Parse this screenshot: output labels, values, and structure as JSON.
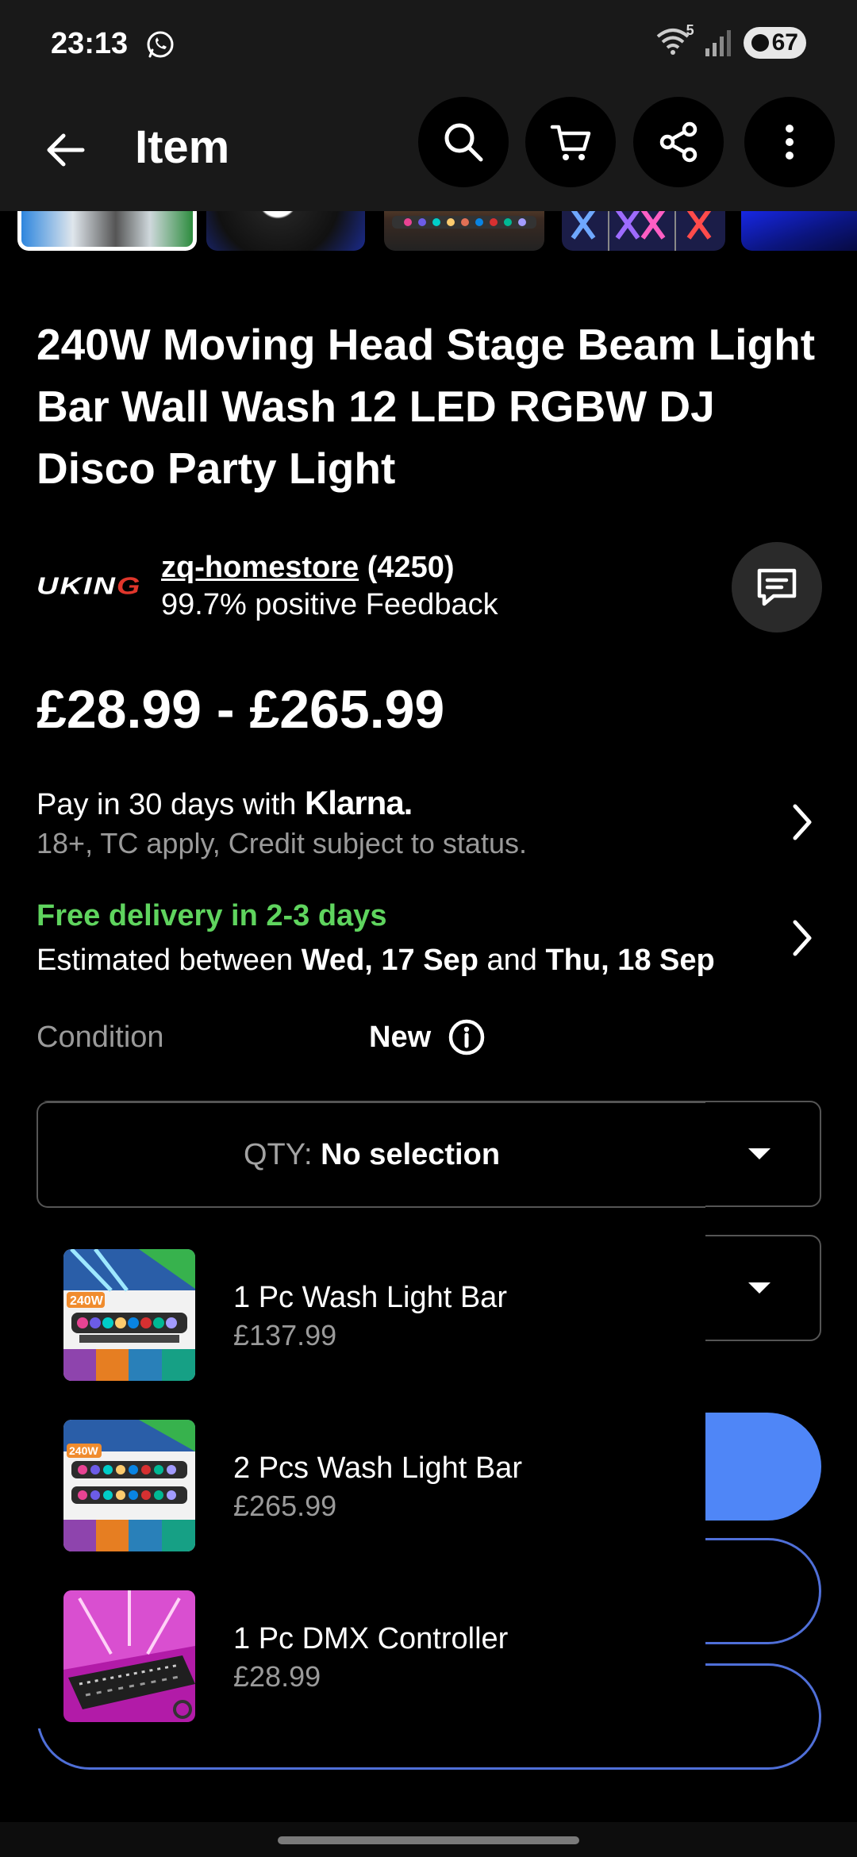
{
  "status_bar": {
    "time": "23:13",
    "network_badge": "5",
    "battery": "67",
    "icons": [
      "whatsapp-icon",
      "wifi-icon",
      "signal-icon",
      "battery-icon"
    ]
  },
  "app_bar": {
    "title": "Item",
    "icons": [
      "back-arrow-icon",
      "search-icon",
      "cart-icon",
      "share-icon",
      "more-vertical-icon"
    ]
  },
  "item": {
    "title": "240W Moving Head Stage Beam Light Bar Wall Wash 12 LED RGBW DJ Disco Party Light",
    "price_range": "£28.99 - £265.99"
  },
  "seller": {
    "logo_text": "UKING",
    "name": "zq-homestore",
    "count": "(4250)",
    "feedback": "99.7% positive Feedback"
  },
  "klarna": {
    "prefix": "Pay in 30 days with",
    "brand": "Klarna.",
    "subtext": "18+, TC apply, Credit subject to status."
  },
  "delivery": {
    "title": "Free delivery in 2-3 days",
    "est_prefix": "Estimated between",
    "date1": "Wed, 17 Sep",
    "and": "and",
    "date2": "Thu, 18 Sep"
  },
  "condition": {
    "label": "Condition",
    "value": "New"
  },
  "quantity_dropdown": {
    "label": "QTY:",
    "value": "No selection",
    "options": [
      {
        "title": "1 Pc Wash Light Bar",
        "price": "£137.99"
      },
      {
        "title": "2 Pcs Wash Light Bar",
        "price": "£265.99"
      },
      {
        "title": "1 Pc DMX Controller",
        "price": "£28.99"
      }
    ]
  },
  "colors": {
    "accent_blue": "#4f86f7",
    "delivery_green": "#5fd45e",
    "bar_bg": "#191919"
  }
}
